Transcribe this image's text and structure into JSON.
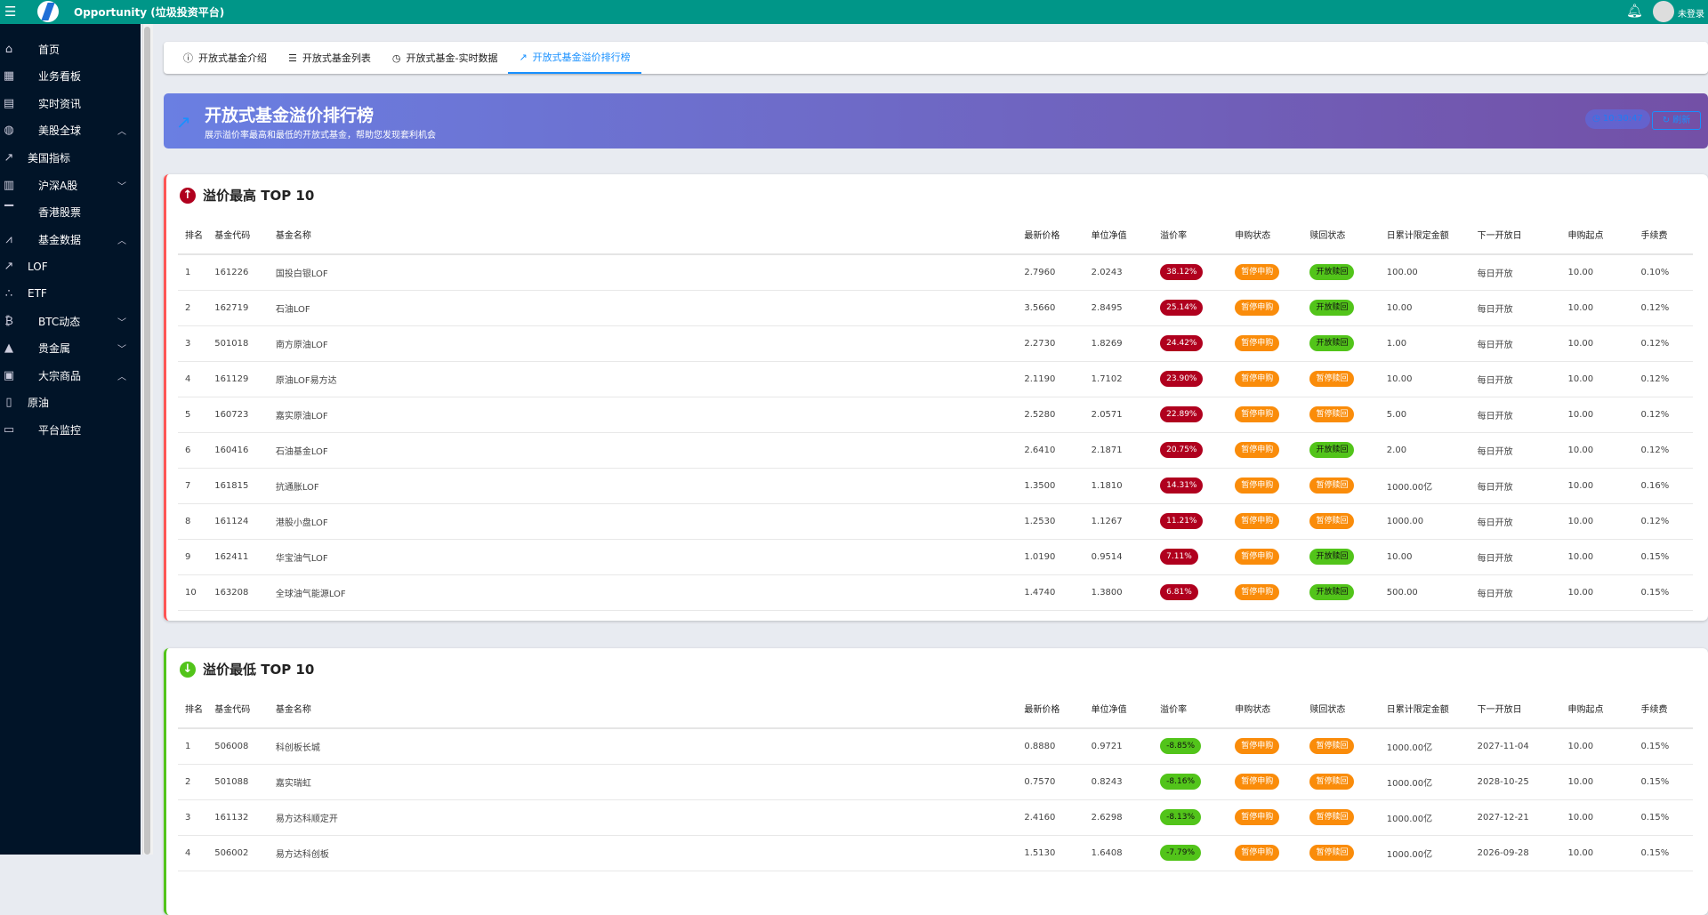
{
  "header": {
    "title": "Opportunity (垃圾投资平台)",
    "user": "未登录"
  },
  "sidebar": [
    {
      "label": "首页",
      "icon": "home-icon",
      "glyph": "⌂"
    },
    {
      "label": "业务看板",
      "icon": "dashboard-icon",
      "glyph": "▦"
    },
    {
      "label": "实时资讯",
      "icon": "news-icon",
      "glyph": "▤"
    },
    {
      "label": "美股全球",
      "icon": "globe-icon",
      "glyph": "◍",
      "chev": "^"
    },
    {
      "label": "美国指标",
      "icon": "line-chart-icon",
      "glyph": "↗",
      "sub": true
    },
    {
      "label": "沪深A股",
      "icon": "bar-chart-icon",
      "glyph": "▥",
      "chev": "v"
    },
    {
      "label": "香港股票",
      "icon": "bank-icon",
      "glyph": "▔"
    },
    {
      "label": "基金数据",
      "icon": "fund-icon",
      "glyph": "⩘",
      "chev": "^"
    },
    {
      "label": "LOF",
      "icon": "line-chart-icon",
      "glyph": "↗",
      "sub": true
    },
    {
      "label": "ETF",
      "icon": "dots-icon",
      "glyph": "∴",
      "sub": true
    },
    {
      "label": "BTC动态",
      "icon": "bitcoin-icon",
      "glyph": "₿",
      "chev": "v"
    },
    {
      "label": "贵金属",
      "icon": "gold-icon",
      "glyph": "▲",
      "chev": "v"
    },
    {
      "label": "大宗商品",
      "icon": "commodity-icon",
      "glyph": "▣",
      "chev": "^"
    },
    {
      "label": "原油",
      "icon": "oil-icon",
      "glyph": "▯",
      "sub": true
    },
    {
      "label": "平台监控",
      "icon": "monitor-icon",
      "glyph": "▭"
    }
  ],
  "tabs": [
    {
      "label": "开放式基金介绍",
      "glyph": "ⓘ",
      "icon": "info-icon"
    },
    {
      "label": "开放式基金列表",
      "glyph": "☰",
      "icon": "list-icon"
    },
    {
      "label": "开放式基金-实时数据",
      "glyph": "◷",
      "icon": "clock-icon"
    },
    {
      "label": "开放式基金溢价排行榜",
      "glyph": "↗",
      "icon": "trend-icon",
      "active": true
    }
  ],
  "banner": {
    "title": "开放式基金溢价排行榜",
    "subtitle": "展示溢价率最高和最低的开放式基金，帮助您发现套利机会",
    "time": "10:30:47",
    "refresh": "刷新"
  },
  "columns": [
    "排名",
    "基金代码",
    "基金名称",
    "最新价格",
    "单位净值",
    "溢价率",
    "申购状态",
    "赎回状态",
    "日累计限定金额",
    "下一开放日",
    "申购起点",
    "手续费"
  ],
  "top": {
    "title": "溢价最高 TOP 10",
    "rows": [
      [
        "1",
        "161226",
        "国投白银LOF",
        "2.7960",
        "2.0243",
        "38.12%",
        "暂停申购",
        "开放赎回",
        "100.00",
        "每日开放",
        "10.00",
        "0.10%"
      ],
      [
        "2",
        "162719",
        "石油LOF",
        "3.5660",
        "2.8495",
        "25.14%",
        "暂停申购",
        "开放赎回",
        "10.00",
        "每日开放",
        "10.00",
        "0.12%"
      ],
      [
        "3",
        "501018",
        "南方原油LOF",
        "2.2730",
        "1.8269",
        "24.42%",
        "暂停申购",
        "开放赎回",
        "1.00",
        "每日开放",
        "10.00",
        "0.12%"
      ],
      [
        "4",
        "161129",
        "原油LOF易方达",
        "2.1190",
        "1.7102",
        "23.90%",
        "暂停申购",
        "暂停赎回",
        "10.00",
        "每日开放",
        "10.00",
        "0.12%"
      ],
      [
        "5",
        "160723",
        "嘉实原油LOF",
        "2.5280",
        "2.0571",
        "22.89%",
        "暂停申购",
        "暂停赎回",
        "5.00",
        "每日开放",
        "10.00",
        "0.12%"
      ],
      [
        "6",
        "160416",
        "石油基金LOF",
        "2.6410",
        "2.1871",
        "20.75%",
        "暂停申购",
        "开放赎回",
        "2.00",
        "每日开放",
        "10.00",
        "0.12%"
      ],
      [
        "7",
        "161815",
        "抗通胀LOF",
        "1.3500",
        "1.1810",
        "14.31%",
        "暂停申购",
        "暂停赎回",
        "1000.00亿",
        "每日开放",
        "10.00",
        "0.16%"
      ],
      [
        "8",
        "161124",
        "港股小盘LOF",
        "1.2530",
        "1.1267",
        "11.21%",
        "暂停申购",
        "暂停赎回",
        "1000.00",
        "每日开放",
        "10.00",
        "0.12%"
      ],
      [
        "9",
        "162411",
        "华宝油气LOF",
        "1.0190",
        "0.9514",
        "7.11%",
        "暂停申购",
        "开放赎回",
        "10.00",
        "每日开放",
        "10.00",
        "0.15%"
      ],
      [
        "10",
        "163208",
        "全球油气能源LOF",
        "1.4740",
        "1.3800",
        "6.81%",
        "暂停申购",
        "开放赎回",
        "500.00",
        "每日开放",
        "10.00",
        "0.15%"
      ]
    ]
  },
  "low": {
    "title": "溢价最低 TOP 10",
    "rows": [
      [
        "1",
        "506008",
        "科创板长城",
        "0.8880",
        "0.9721",
        "-8.85%",
        "暂停申购",
        "暂停赎回",
        "1000.00亿",
        "2027-11-04",
        "10.00",
        "0.15%"
      ],
      [
        "2",
        "501088",
        "嘉实瑞虹",
        "0.7570",
        "0.8243",
        "-8.16%",
        "暂停申购",
        "暂停赎回",
        "1000.00亿",
        "2028-10-25",
        "10.00",
        "0.15%"
      ],
      [
        "3",
        "161132",
        "易方达科顺定开",
        "2.4160",
        "2.6298",
        "-8.13%",
        "暂停申购",
        "暂停赎回",
        "1000.00亿",
        "2027-12-21",
        "10.00",
        "0.15%"
      ],
      [
        "4",
        "506002",
        "易方达科创板",
        "1.5130",
        "1.6408",
        "-7.79%",
        "暂停申购",
        "暂停赎回",
        "1000.00亿",
        "2026-09-28",
        "10.00",
        "0.15%"
      ]
    ]
  },
  "colors": {
    "header": "#009688",
    "sidebar": "#011428",
    "accent": "#1890ff",
    "premium_high": "#b0001e",
    "premium_low": "#52c41a",
    "paused": "#fa8c0a",
    "open": "#52c41a"
  }
}
